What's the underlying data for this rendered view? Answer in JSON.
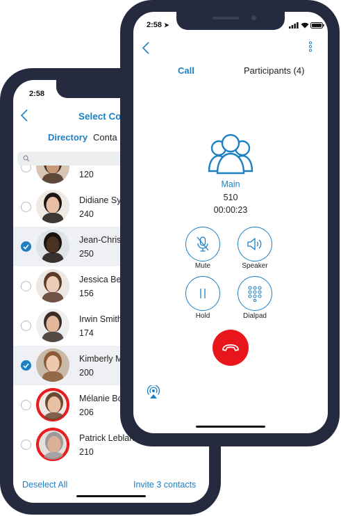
{
  "back_phone": {
    "status_time": "2:58",
    "header_title": "Select Co",
    "tabs": [
      {
        "label": "Directory",
        "active": true
      },
      {
        "label": "Conta",
        "active": false
      }
    ],
    "search_icon": "search-icon",
    "contacts": [
      {
        "name": "",
        "ext": "120",
        "selected": false,
        "skin": "#c99a7a",
        "hair": "#4a3023",
        "bg": "#d8c6b5"
      },
      {
        "name": "Didiane Sy",
        "ext": "240",
        "selected": false,
        "skin": "#e6bfa5",
        "hair": "#1e1714",
        "bg": "#efe9e4"
      },
      {
        "name": "Jean-Chris",
        "ext": "250",
        "selected": true,
        "skin": "#4a3122",
        "hair": "#1a120e",
        "bg": "#dde2e6"
      },
      {
        "name": "Jessica Bea",
        "ext": "156",
        "selected": false,
        "skin": "#eccbb6",
        "hair": "#5b3a2a",
        "bg": "#ece7e3"
      },
      {
        "name": "Irwin Smith",
        "ext": "174",
        "selected": false,
        "skin": "#e2b79b",
        "hair": "#3a2c24",
        "bg": "#eeeeee"
      },
      {
        "name": "Kimberly M",
        "ext": "200",
        "selected": true,
        "skin": "#efc9ae",
        "hair": "#8a5a36",
        "bg": "#c9b9a8"
      },
      {
        "name": "Mélanie Bo",
        "ext": "206",
        "selected": false,
        "skin": "#e8c0a6",
        "hair": "#6b4934",
        "bg": "#f0e9e3"
      },
      {
        "name": "Patrick Leblanc",
        "ext": "210",
        "selected": false,
        "skin": "#dcb096",
        "hair": "#9a9a9a",
        "bg": "#e4dfdb"
      }
    ],
    "footer": {
      "deselect_label": "Deselect All",
      "invite_label": "Invite 3 contacts"
    }
  },
  "front_phone": {
    "status_time": "2:58",
    "tabs": [
      {
        "label": "Call",
        "active": true
      },
      {
        "label": "Participants (4)",
        "active": false
      }
    ],
    "call": {
      "name": "Main",
      "ext": "510",
      "timer": "00:00:23"
    },
    "controls": [
      {
        "label": "Mute",
        "icon": "mic-off-icon"
      },
      {
        "label": "Speaker",
        "icon": "speaker-icon"
      },
      {
        "label": "Hold",
        "icon": "pause-icon"
      },
      {
        "label": "Dialpad",
        "icon": "dialpad-icon"
      }
    ],
    "end_call_icon": "hang-up-icon",
    "audio_route_icon": "airplay-icon"
  },
  "colors": {
    "accent": "#1d7fc4",
    "frame": "#262a3e",
    "end_call": "#e8161b",
    "selected_row": "#eef0f3"
  }
}
